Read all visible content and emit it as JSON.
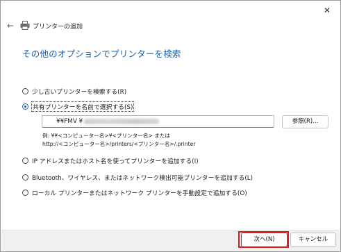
{
  "window": {
    "title": "プリンターの追加",
    "close_glyph": "✕",
    "back_glyph": "←"
  },
  "heading": "その他のオプションでプリンターを検索",
  "options": [
    {
      "label": "少し古いプリンターを検索する(R)",
      "checked": false
    },
    {
      "label": "共有プリンターを名前で選択する(S)",
      "checked": true
    },
    {
      "label": "IP アドレスまたはホスト名を使ってプリンターを追加する(I)",
      "checked": false
    },
    {
      "label": "Bluetooth、ワイヤレス、またはネットワーク検出可能プリンターを追加する(L)",
      "checked": false
    },
    {
      "label": "ローカル プリンターまたはネットワーク プリンターを手動設定で追加する(O)",
      "checked": false
    }
  ],
  "share_name_field": {
    "value": "¥¥FMV ¥"
  },
  "browse_button": "参照(R)...",
  "example": {
    "line1": "例: ¥¥<コンピューター名>¥<プリンター名> または",
    "line2": "http://<コンピューター名>/printers/<プリンター名>/.printer"
  },
  "footer": {
    "next_label": "次へ(N)",
    "cancel_label": "キャンセル"
  },
  "colors": {
    "accent": "#1a5fa8",
    "highlight": "#d81b1b"
  }
}
